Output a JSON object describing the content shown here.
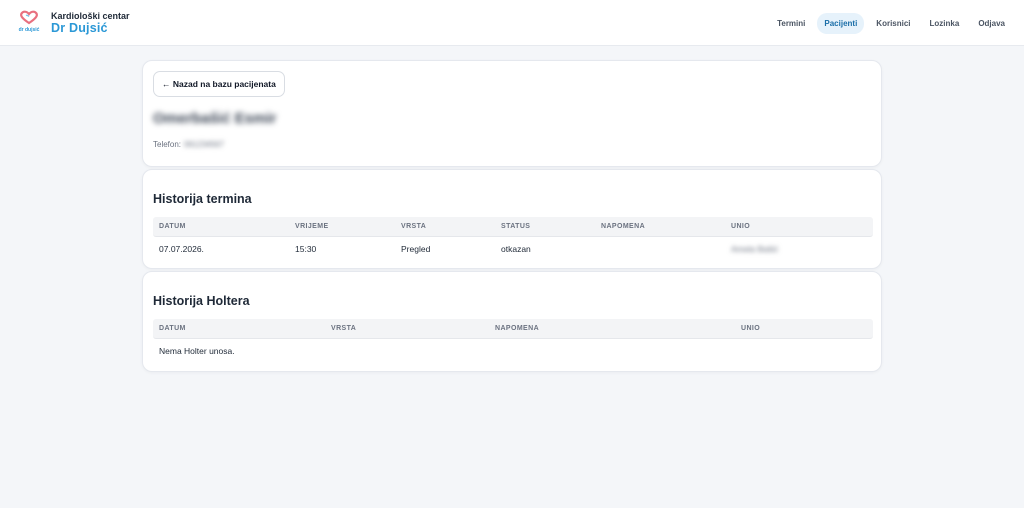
{
  "header": {
    "brand_line1": "Kardiološki centar",
    "brand_line2": "Dr Dujsić",
    "logo_text": "dr dujsić",
    "nav": [
      "Termini",
      "Pacijenti",
      "Korisnici",
      "Lozinka",
      "Odjava"
    ],
    "active_nav": "Pacijenti"
  },
  "patient": {
    "back_label": "← Nazad na bazu pacijenata",
    "name": "Omerbašić Esmir",
    "phone_label": "Telefon:",
    "phone_value": "061234567"
  },
  "appointments": {
    "title": "Historija termina",
    "columns": [
      "DATUM",
      "VRIJEME",
      "VRSTA",
      "STATUS",
      "NAPOMENA",
      "UNIO"
    ],
    "rows": [
      {
        "datum": "07.07.2026.",
        "vrijeme": "15:30",
        "vrsta": "Pregled",
        "status": "otkazan",
        "napomena": "",
        "unio": "Amela Bašić"
      }
    ]
  },
  "holter": {
    "title": "Historija Holtera",
    "columns": [
      "DATUM",
      "VRSTA",
      "NAPOMENA",
      "UNIO"
    ],
    "empty": "Nema Holter unosa."
  },
  "colors": {
    "accent": "#2b98d6",
    "active_nav_bg": "#e6f2fb",
    "logo_heart": "#e8707f"
  }
}
